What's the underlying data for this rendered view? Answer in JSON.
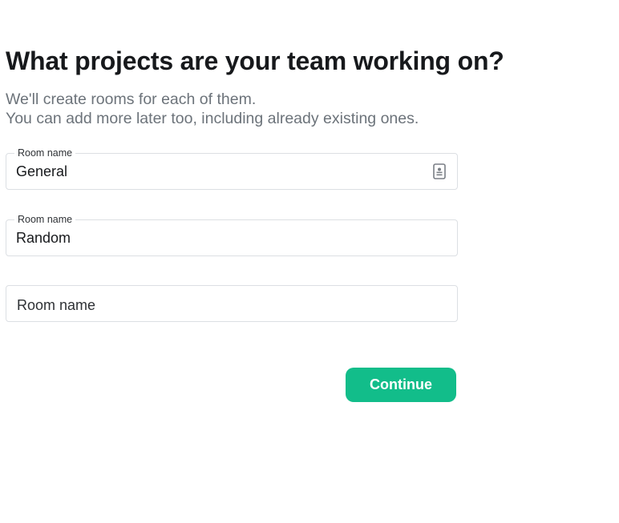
{
  "heading": "What projects are your team working on?",
  "subtitle": {
    "line1": "We'll create rooms for each of them.",
    "line2": "You can add more later too, including already existing ones."
  },
  "fields": [
    {
      "label": "Room name",
      "value": "General",
      "icon": "contact-card-icon"
    },
    {
      "label": "Room name",
      "value": "Random"
    },
    {
      "label": "",
      "value": "",
      "placeholder": "Room name"
    }
  ],
  "actions": {
    "continue_label": "Continue"
  },
  "colors": {
    "accent": "#12bd8a",
    "text": "#17191c",
    "muted": "#6c737a",
    "border": "#dcdfe3"
  }
}
